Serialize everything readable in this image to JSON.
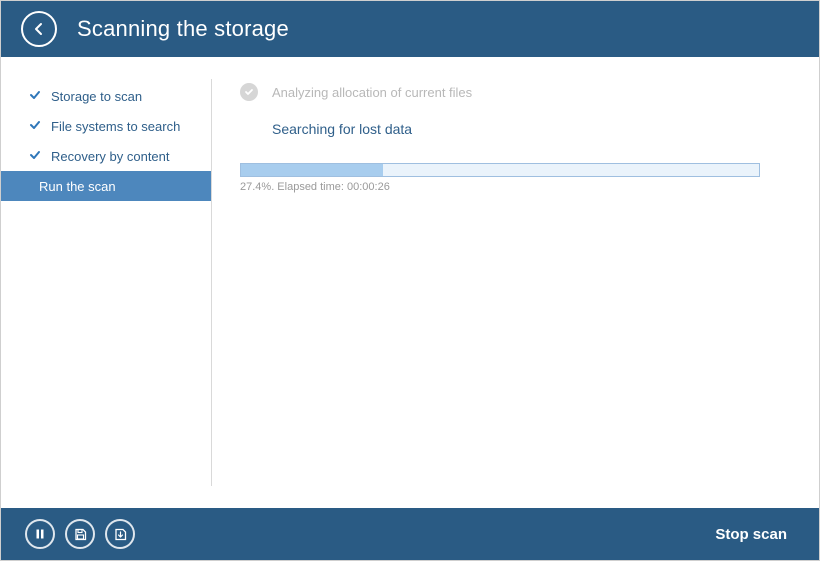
{
  "header": {
    "title": "Scanning the storage"
  },
  "sidebar": {
    "steps": [
      {
        "label": "Storage to scan",
        "done": true
      },
      {
        "label": "File systems to search",
        "done": true
      },
      {
        "label": "Recovery by content",
        "done": true
      },
      {
        "label": "Run the scan",
        "active": true
      }
    ]
  },
  "main": {
    "completed_step": "Analyzing allocation of current files",
    "current_step": "Searching for lost data",
    "progress_percent": 27.4,
    "status_text": "27.4%. Elapsed time: 00:00:26"
  },
  "footer": {
    "stop_label": "Stop scan"
  }
}
